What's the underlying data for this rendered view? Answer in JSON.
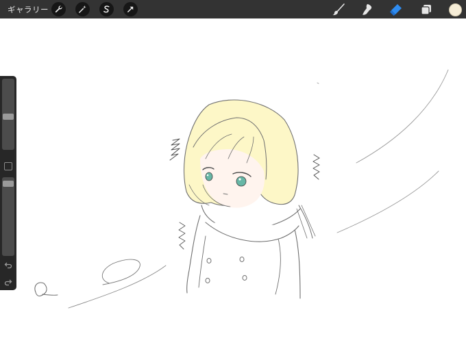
{
  "topbar": {
    "gallery_label": "ギャラリー",
    "left_tools": [
      {
        "name": "wrench-icon"
      },
      {
        "name": "magic-wand-icon"
      },
      {
        "name": "selection-icon"
      },
      {
        "name": "transform-arrow-icon"
      }
    ],
    "right_tools": [
      {
        "name": "brush-icon"
      },
      {
        "name": "smudge-icon"
      },
      {
        "name": "eraser-icon",
        "active": true
      },
      {
        "name": "layers-icon"
      }
    ],
    "current_color": "#f6edd7"
  },
  "sidebar": {
    "brush_size_level": 0.46,
    "opacity_level": 0.04,
    "modify_button": "square-icon",
    "undo": "undo-icon",
    "redo": "redo-icon"
  },
  "colors": {
    "toolbar_bg": "#333333",
    "accent_blue": "#2f8cf0",
    "hair_fill": "#fdf7c7",
    "skin_fill": "#fff4ee",
    "eye_color": "#67b7a6"
  }
}
